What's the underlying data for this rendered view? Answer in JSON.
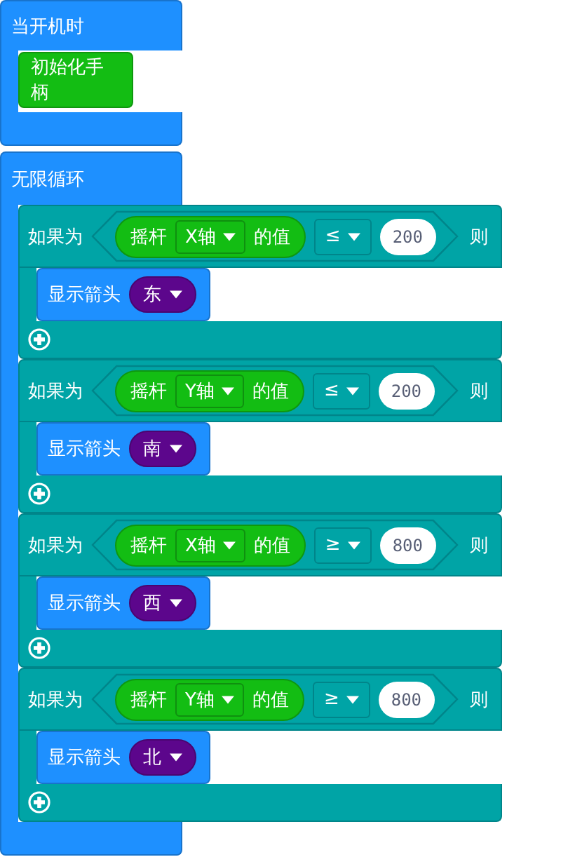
{
  "blocks": [
    {
      "kind": "event",
      "label": "当开机时",
      "body": [
        {
          "label": "初始化手柄"
        }
      ]
    },
    {
      "kind": "loop",
      "label": "无限循环",
      "body": [
        {
          "label": "如果为",
          "sensor": "摇杆",
          "axis": "X轴",
          "suffix": "的值",
          "operator": "≤",
          "value": "200",
          "then": "则",
          "action": "显示箭头",
          "direction": "东"
        },
        {
          "label": "如果为",
          "sensor": "摇杆",
          "axis": "Y轴",
          "suffix": "的值",
          "operator": "≤",
          "value": "200",
          "then": "则",
          "action": "显示箭头",
          "direction": "南"
        },
        {
          "label": "如果为",
          "sensor": "摇杆",
          "axis": "X轴",
          "suffix": "的值",
          "operator": "≥",
          "value": "800",
          "then": "则",
          "action": "显示箭头",
          "direction": "西"
        },
        {
          "label": "如果为",
          "sensor": "摇杆",
          "axis": "Y轴",
          "suffix": "的值",
          "operator": "≥",
          "value": "800",
          "then": "则",
          "action": "显示箭头",
          "direction": "北"
        }
      ]
    }
  ]
}
